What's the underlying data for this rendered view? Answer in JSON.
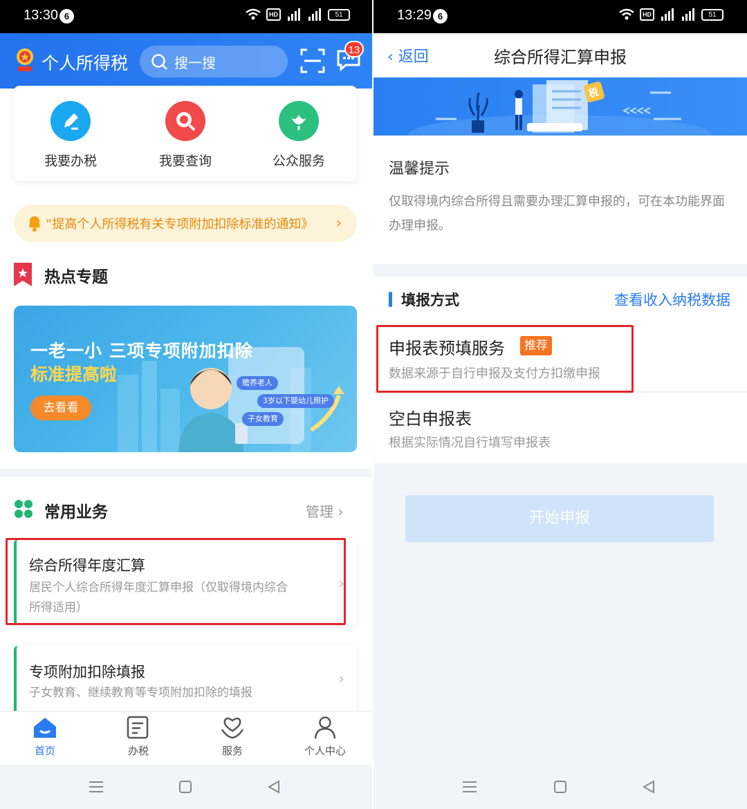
{
  "left": {
    "status": {
      "time": "13:30",
      "notif": "6",
      "hd": "HD",
      "battery": "51"
    },
    "header": {
      "title": "个人所得税",
      "search_placeholder": "搜一搜",
      "badge": "13"
    },
    "quick": [
      {
        "label": "我要办税",
        "icon": "edit-icon",
        "color": "#1aa8f0"
      },
      {
        "label": "我要查询",
        "icon": "magnifier-icon",
        "color": "#f04a4a"
      },
      {
        "label": "公众服务",
        "icon": "flower-icon",
        "color": "#2cc07e"
      }
    ],
    "notice": "“提高个人所得税有关专项附加扣除标准的通知》",
    "hot_title": "热点专题",
    "banner": {
      "line1": "一老一小 三项专项附加扣除",
      "line2": "标准提高啦",
      "button": "去看看",
      "tags": [
        "赡养老人",
        "3岁以下婴幼儿照护",
        "子女教育"
      ]
    },
    "common": {
      "title": "常用业务",
      "manage": "管理"
    },
    "items": [
      {
        "title": "综合所得年度汇算",
        "sub1": "居民个人综合所得年度汇算申报（仅取得境内综合",
        "sub2": "所得适用）"
      },
      {
        "title": "专项附加扣除填报",
        "sub1": "子女教育、继续教育等专项附加扣除的填报"
      }
    ],
    "tabs": [
      {
        "label": "首页",
        "icon": "home-icon"
      },
      {
        "label": "办税",
        "icon": "document-icon"
      },
      {
        "label": "服务",
        "icon": "heart-hands-icon"
      },
      {
        "label": "个人中心",
        "icon": "user-icon"
      }
    ]
  },
  "right": {
    "status": {
      "time": "13:29",
      "notif": "6",
      "hd": "HD",
      "battery": "51"
    },
    "nav": {
      "back": "返回",
      "title": "综合所得汇算申报"
    },
    "banner_badge": "税",
    "tip": {
      "title": "温馨提示",
      "text": "仅取得境内综合所得且需要办理汇算申报的，可在本功能界面办理申报。"
    },
    "method": {
      "title": "填报方式",
      "link": "查看收入纳税数据"
    },
    "options": [
      {
        "title": "申报表预填服务",
        "badge": "推荐",
        "sub": "数据来源于自行申报及支付方扣缴申报"
      },
      {
        "title": "空白申报表",
        "sub": "根据实际情况自行填写申报表"
      }
    ],
    "start_button": "开始申报"
  },
  "colors": {
    "primary": "#2a7cf0",
    "highlight_box": "#e5252a",
    "recommend": "#f6731f",
    "notice_text": "#e38a0d"
  }
}
